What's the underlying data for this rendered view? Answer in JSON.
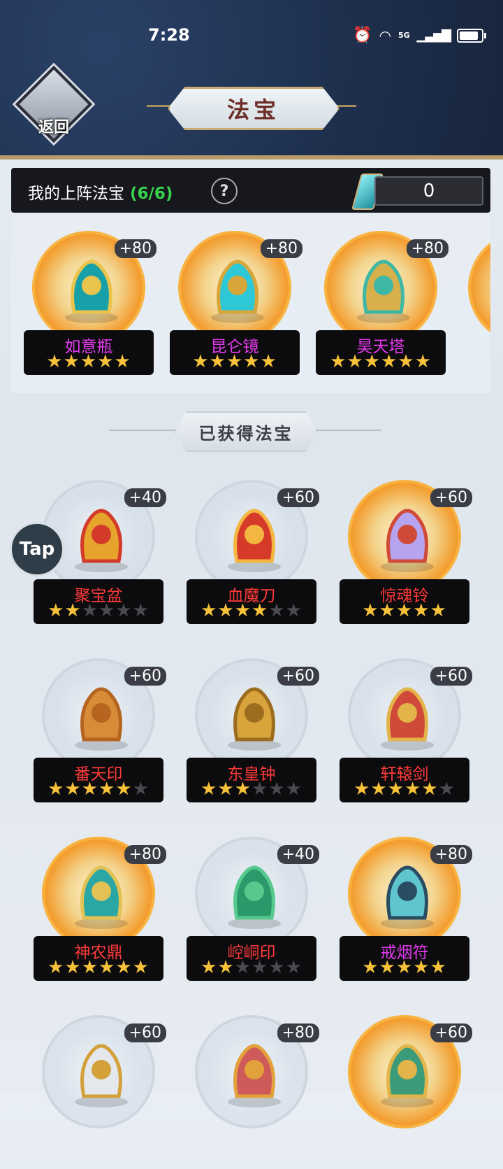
{
  "status": {
    "time": "7:28",
    "signal_label": "5G",
    "battery_level": 0.85
  },
  "header": {
    "back_label": "返回",
    "title": "法宝"
  },
  "equipped": {
    "label": "我的上阵法宝",
    "count": "(6/6)",
    "help": "?",
    "currency_value": "0",
    "items": [
      {
        "name": "如意瓶",
        "bonus": "+80",
        "stars": 5,
        "max": 5,
        "glow": true,
        "name_color": "#e33aee",
        "icon": "vase-icon"
      },
      {
        "name": "昆仑镜",
        "bonus": "+80",
        "stars": 5,
        "max": 5,
        "glow": true,
        "name_color": "#e33aee",
        "icon": "mirror-icon"
      },
      {
        "name": "昊天塔",
        "bonus": "+80",
        "stars": 6,
        "max": 6,
        "glow": true,
        "name_color": "#e33aee",
        "icon": "tower-icon"
      }
    ]
  },
  "section_title": "已获得法宝",
  "tap_label": "Tap",
  "owned": [
    {
      "name": "聚宝盆",
      "bonus": "+40",
      "stars": 2,
      "max": 6,
      "glow": false,
      "name_color": "#ff3a3a",
      "icon": "treasure-bowl-icon"
    },
    {
      "name": "血魔刀",
      "bonus": "+60",
      "stars": 4,
      "max": 6,
      "glow": false,
      "name_color": "#ff3a3a",
      "icon": "blood-blade-icon"
    },
    {
      "name": "惊魂铃",
      "bonus": "+60",
      "stars": 5,
      "max": 5,
      "glow": true,
      "name_color": "#ff3a3a",
      "icon": "bell-icon"
    },
    {
      "name": "番天印",
      "bonus": "+60",
      "stars": 5,
      "max": 6,
      "glow": false,
      "name_color": "#ff3a3a",
      "icon": "seal-icon"
    },
    {
      "name": "东皇钟",
      "bonus": "+60",
      "stars": 3,
      "max": 6,
      "glow": false,
      "name_color": "#ff3a3a",
      "icon": "golden-bell-icon"
    },
    {
      "name": "轩辕剑",
      "bonus": "+60",
      "stars": 5,
      "max": 6,
      "glow": false,
      "name_color": "#ff3a3a",
      "icon": "sword-icon"
    },
    {
      "name": "神农鼎",
      "bonus": "+80",
      "stars": 6,
      "max": 6,
      "glow": true,
      "name_color": "#ff3a3a",
      "icon": "cauldron-icon"
    },
    {
      "name": "崆峒印",
      "bonus": "+40",
      "stars": 2,
      "max": 6,
      "glow": false,
      "name_color": "#ff3a3a",
      "icon": "jade-seal-icon"
    },
    {
      "name": "戒烟符",
      "bonus": "+80",
      "stars": 5,
      "max": 5,
      "glow": true,
      "name_color": "#e33aee",
      "icon": "talisman-icon"
    },
    {
      "name": "",
      "bonus": "+60",
      "stars": 0,
      "max": 0,
      "glow": false,
      "name_color": "#ff3a3a",
      "icon": "axe-icon"
    },
    {
      "name": "",
      "bonus": "+80",
      "stars": 0,
      "max": 0,
      "glow": false,
      "name_color": "#ff3a3a",
      "icon": "flute-icon"
    },
    {
      "name": "",
      "bonus": "+60",
      "stars": 0,
      "max": 0,
      "glow": true,
      "name_color": "#ff3a3a",
      "icon": "green-sword-icon"
    }
  ]
}
